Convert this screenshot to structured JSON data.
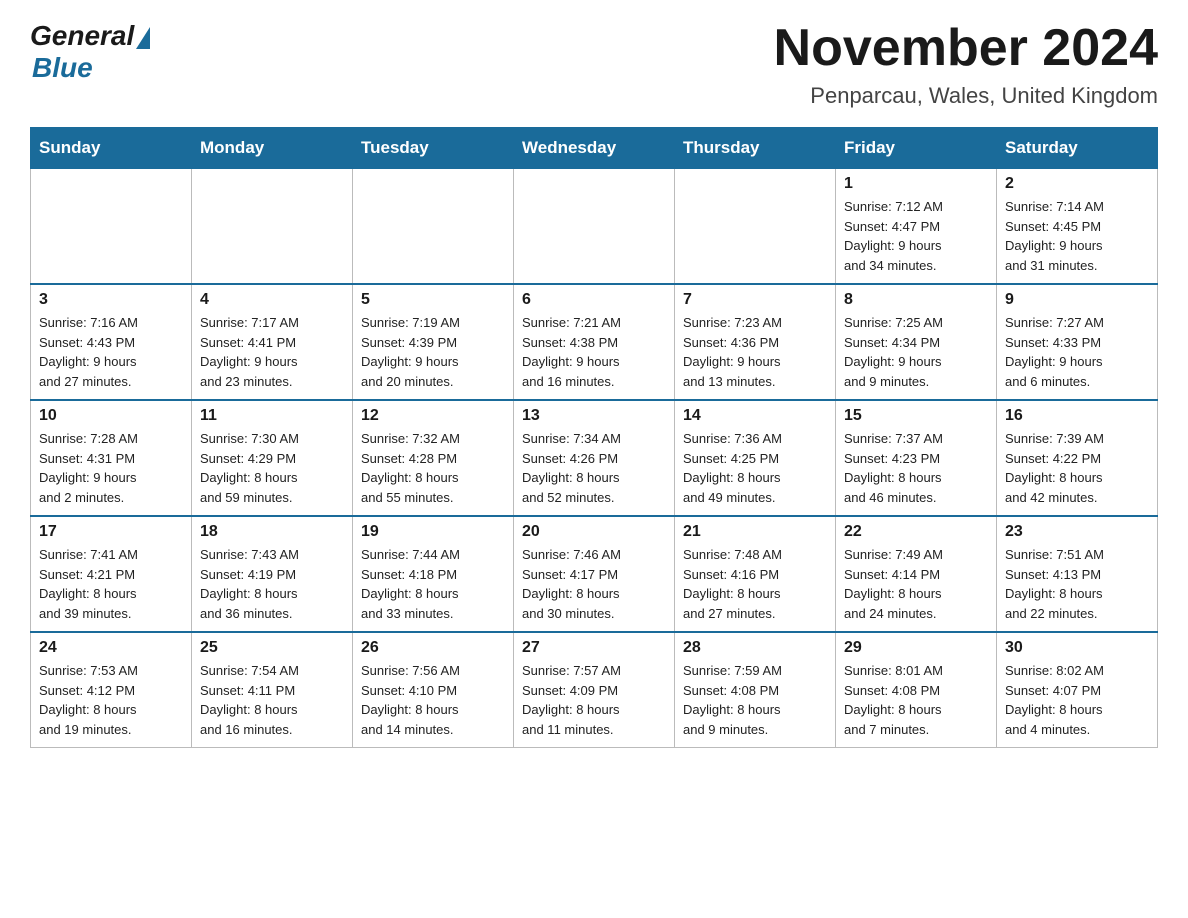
{
  "header": {
    "logo_general": "General",
    "logo_blue": "Blue",
    "title": "November 2024",
    "subtitle": "Penparcau, Wales, United Kingdom"
  },
  "days_of_week": [
    "Sunday",
    "Monday",
    "Tuesday",
    "Wednesday",
    "Thursday",
    "Friday",
    "Saturday"
  ],
  "weeks": [
    [
      {
        "day": "",
        "info": ""
      },
      {
        "day": "",
        "info": ""
      },
      {
        "day": "",
        "info": ""
      },
      {
        "day": "",
        "info": ""
      },
      {
        "day": "",
        "info": ""
      },
      {
        "day": "1",
        "info": "Sunrise: 7:12 AM\nSunset: 4:47 PM\nDaylight: 9 hours\nand 34 minutes."
      },
      {
        "day": "2",
        "info": "Sunrise: 7:14 AM\nSunset: 4:45 PM\nDaylight: 9 hours\nand 31 minutes."
      }
    ],
    [
      {
        "day": "3",
        "info": "Sunrise: 7:16 AM\nSunset: 4:43 PM\nDaylight: 9 hours\nand 27 minutes."
      },
      {
        "day": "4",
        "info": "Sunrise: 7:17 AM\nSunset: 4:41 PM\nDaylight: 9 hours\nand 23 minutes."
      },
      {
        "day": "5",
        "info": "Sunrise: 7:19 AM\nSunset: 4:39 PM\nDaylight: 9 hours\nand 20 minutes."
      },
      {
        "day": "6",
        "info": "Sunrise: 7:21 AM\nSunset: 4:38 PM\nDaylight: 9 hours\nand 16 minutes."
      },
      {
        "day": "7",
        "info": "Sunrise: 7:23 AM\nSunset: 4:36 PM\nDaylight: 9 hours\nand 13 minutes."
      },
      {
        "day": "8",
        "info": "Sunrise: 7:25 AM\nSunset: 4:34 PM\nDaylight: 9 hours\nand 9 minutes."
      },
      {
        "day": "9",
        "info": "Sunrise: 7:27 AM\nSunset: 4:33 PM\nDaylight: 9 hours\nand 6 minutes."
      }
    ],
    [
      {
        "day": "10",
        "info": "Sunrise: 7:28 AM\nSunset: 4:31 PM\nDaylight: 9 hours\nand 2 minutes."
      },
      {
        "day": "11",
        "info": "Sunrise: 7:30 AM\nSunset: 4:29 PM\nDaylight: 8 hours\nand 59 minutes."
      },
      {
        "day": "12",
        "info": "Sunrise: 7:32 AM\nSunset: 4:28 PM\nDaylight: 8 hours\nand 55 minutes."
      },
      {
        "day": "13",
        "info": "Sunrise: 7:34 AM\nSunset: 4:26 PM\nDaylight: 8 hours\nand 52 minutes."
      },
      {
        "day": "14",
        "info": "Sunrise: 7:36 AM\nSunset: 4:25 PM\nDaylight: 8 hours\nand 49 minutes."
      },
      {
        "day": "15",
        "info": "Sunrise: 7:37 AM\nSunset: 4:23 PM\nDaylight: 8 hours\nand 46 minutes."
      },
      {
        "day": "16",
        "info": "Sunrise: 7:39 AM\nSunset: 4:22 PM\nDaylight: 8 hours\nand 42 minutes."
      }
    ],
    [
      {
        "day": "17",
        "info": "Sunrise: 7:41 AM\nSunset: 4:21 PM\nDaylight: 8 hours\nand 39 minutes."
      },
      {
        "day": "18",
        "info": "Sunrise: 7:43 AM\nSunset: 4:19 PM\nDaylight: 8 hours\nand 36 minutes."
      },
      {
        "day": "19",
        "info": "Sunrise: 7:44 AM\nSunset: 4:18 PM\nDaylight: 8 hours\nand 33 minutes."
      },
      {
        "day": "20",
        "info": "Sunrise: 7:46 AM\nSunset: 4:17 PM\nDaylight: 8 hours\nand 30 minutes."
      },
      {
        "day": "21",
        "info": "Sunrise: 7:48 AM\nSunset: 4:16 PM\nDaylight: 8 hours\nand 27 minutes."
      },
      {
        "day": "22",
        "info": "Sunrise: 7:49 AM\nSunset: 4:14 PM\nDaylight: 8 hours\nand 24 minutes."
      },
      {
        "day": "23",
        "info": "Sunrise: 7:51 AM\nSunset: 4:13 PM\nDaylight: 8 hours\nand 22 minutes."
      }
    ],
    [
      {
        "day": "24",
        "info": "Sunrise: 7:53 AM\nSunset: 4:12 PM\nDaylight: 8 hours\nand 19 minutes."
      },
      {
        "day": "25",
        "info": "Sunrise: 7:54 AM\nSunset: 4:11 PM\nDaylight: 8 hours\nand 16 minutes."
      },
      {
        "day": "26",
        "info": "Sunrise: 7:56 AM\nSunset: 4:10 PM\nDaylight: 8 hours\nand 14 minutes."
      },
      {
        "day": "27",
        "info": "Sunrise: 7:57 AM\nSunset: 4:09 PM\nDaylight: 8 hours\nand 11 minutes."
      },
      {
        "day": "28",
        "info": "Sunrise: 7:59 AM\nSunset: 4:08 PM\nDaylight: 8 hours\nand 9 minutes."
      },
      {
        "day": "29",
        "info": "Sunrise: 8:01 AM\nSunset: 4:08 PM\nDaylight: 8 hours\nand 7 minutes."
      },
      {
        "day": "30",
        "info": "Sunrise: 8:02 AM\nSunset: 4:07 PM\nDaylight: 8 hours\nand 4 minutes."
      }
    ]
  ]
}
